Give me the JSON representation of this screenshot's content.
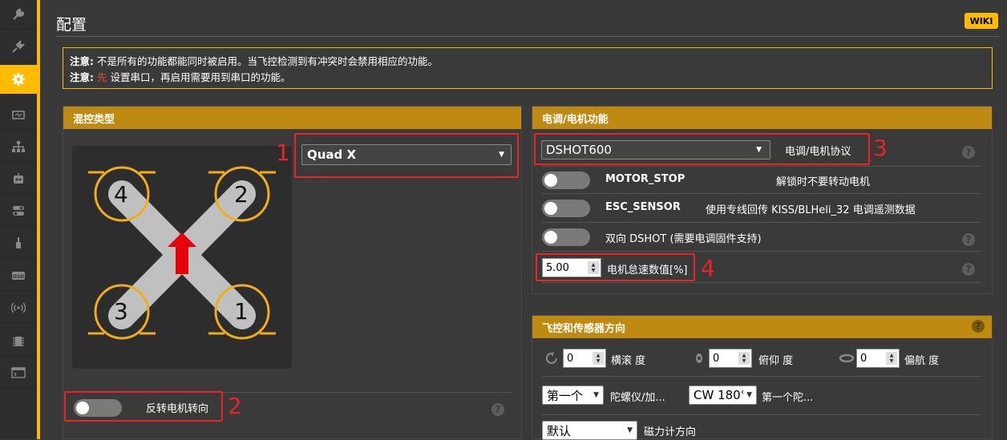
{
  "page": {
    "title": "配置",
    "wiki": "WIKI"
  },
  "notice": {
    "line1_prefix": "注意:",
    "line1_text": " 不是所有的功能都能同时被启用。当飞控检测到有冲突时会禁用相应的功能。",
    "line2_prefix": "注意:",
    "line2_red": " 先",
    "line2_text": " 设置串口，再启用需要用到串口的功能。"
  },
  "mixer": {
    "title": "混控类型",
    "selected": "Quad X",
    "motors": [
      "1",
      "2",
      "3",
      "4"
    ],
    "reverse_label": "反转电机转向"
  },
  "esc": {
    "title": "电调/电机功能",
    "protocol": "DSHOT600",
    "protocol_label": "电调/电机协议",
    "motor_stop": "MOTOR_STOP",
    "motor_stop_desc": "解锁时不要转动电机",
    "esc_sensor": "ESC_SENSOR",
    "esc_sensor_desc": "使用专线回传 KISS/BLHeli_32 电调遥测数据",
    "bidir": "双向 DSHOT (需要电调固件支持)",
    "idle_value": "5.00",
    "idle_label": "电机怠速数值[%]"
  },
  "orientation": {
    "title": "飞控和传感器方向",
    "roll_value": "0",
    "roll_label": "横滚 度",
    "pitch_value": "0",
    "pitch_label": "俯仰 度",
    "yaw_value": "0",
    "yaw_label": "偏航 度",
    "gyro_select": "第一个",
    "gyro_label": "陀螺仪/加...",
    "gyro_align": "CW 180°",
    "gyro_align_label": "第一个陀...",
    "mag_select": "默认",
    "mag_label": "磁力计方向"
  },
  "annotations": [
    "1",
    "2",
    "3",
    "4"
  ],
  "colors": {
    "accent": "#ffbb00",
    "header": "#bf8a11",
    "annotation": "#e8242c"
  }
}
